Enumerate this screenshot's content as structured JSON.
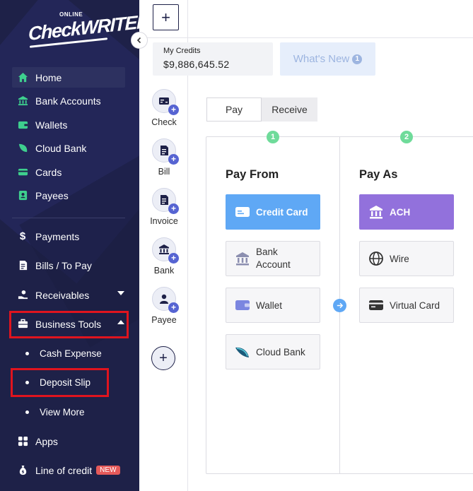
{
  "brand": {
    "small": "ONLINE",
    "name": "CheckWRITER"
  },
  "sidebar": {
    "items": [
      {
        "label": "Home",
        "icon": "home-icon"
      },
      {
        "label": "Bank Accounts",
        "icon": "bank-icon"
      },
      {
        "label": "Wallets",
        "icon": "wallet-icon"
      },
      {
        "label": "Cloud Bank",
        "icon": "leaf-icon"
      },
      {
        "label": "Cards",
        "icon": "card-icon"
      },
      {
        "label": "Payees",
        "icon": "contact-icon"
      }
    ],
    "payments": "Payments",
    "bills": "Bills / To Pay",
    "receivables": "Receivables",
    "business_tools": "Business Tools",
    "sub": [
      "Cash Expense",
      "Deposit Slip",
      "View More"
    ],
    "apps": "Apps",
    "line_of_credit": "Line of credit",
    "new_badge": "NEW"
  },
  "quick_actions": [
    "Check",
    "Bill",
    "Invoice",
    "Bank",
    "Payee"
  ],
  "credits": {
    "label": "My Credits",
    "value": "$9,886,645.52"
  },
  "whats_new": {
    "label": "What's New",
    "count": "1"
  },
  "tabs": [
    "Pay",
    "Receive"
  ],
  "steps": [
    "1",
    "2"
  ],
  "pay_from": {
    "title": "Pay From",
    "options": [
      "Credit Card",
      "Bank Account",
      "Wallet",
      "Cloud Bank"
    ]
  },
  "pay_as": {
    "title": "Pay As",
    "options": [
      "ACH",
      "Wire",
      "Virtual Card"
    ]
  },
  "colors": {
    "sidebar": "#1e2148",
    "accent_green": "#3ecf8e",
    "blue": "#5fa8f5",
    "purple": "#9271dc",
    "highlight_red": "#e0141e"
  }
}
